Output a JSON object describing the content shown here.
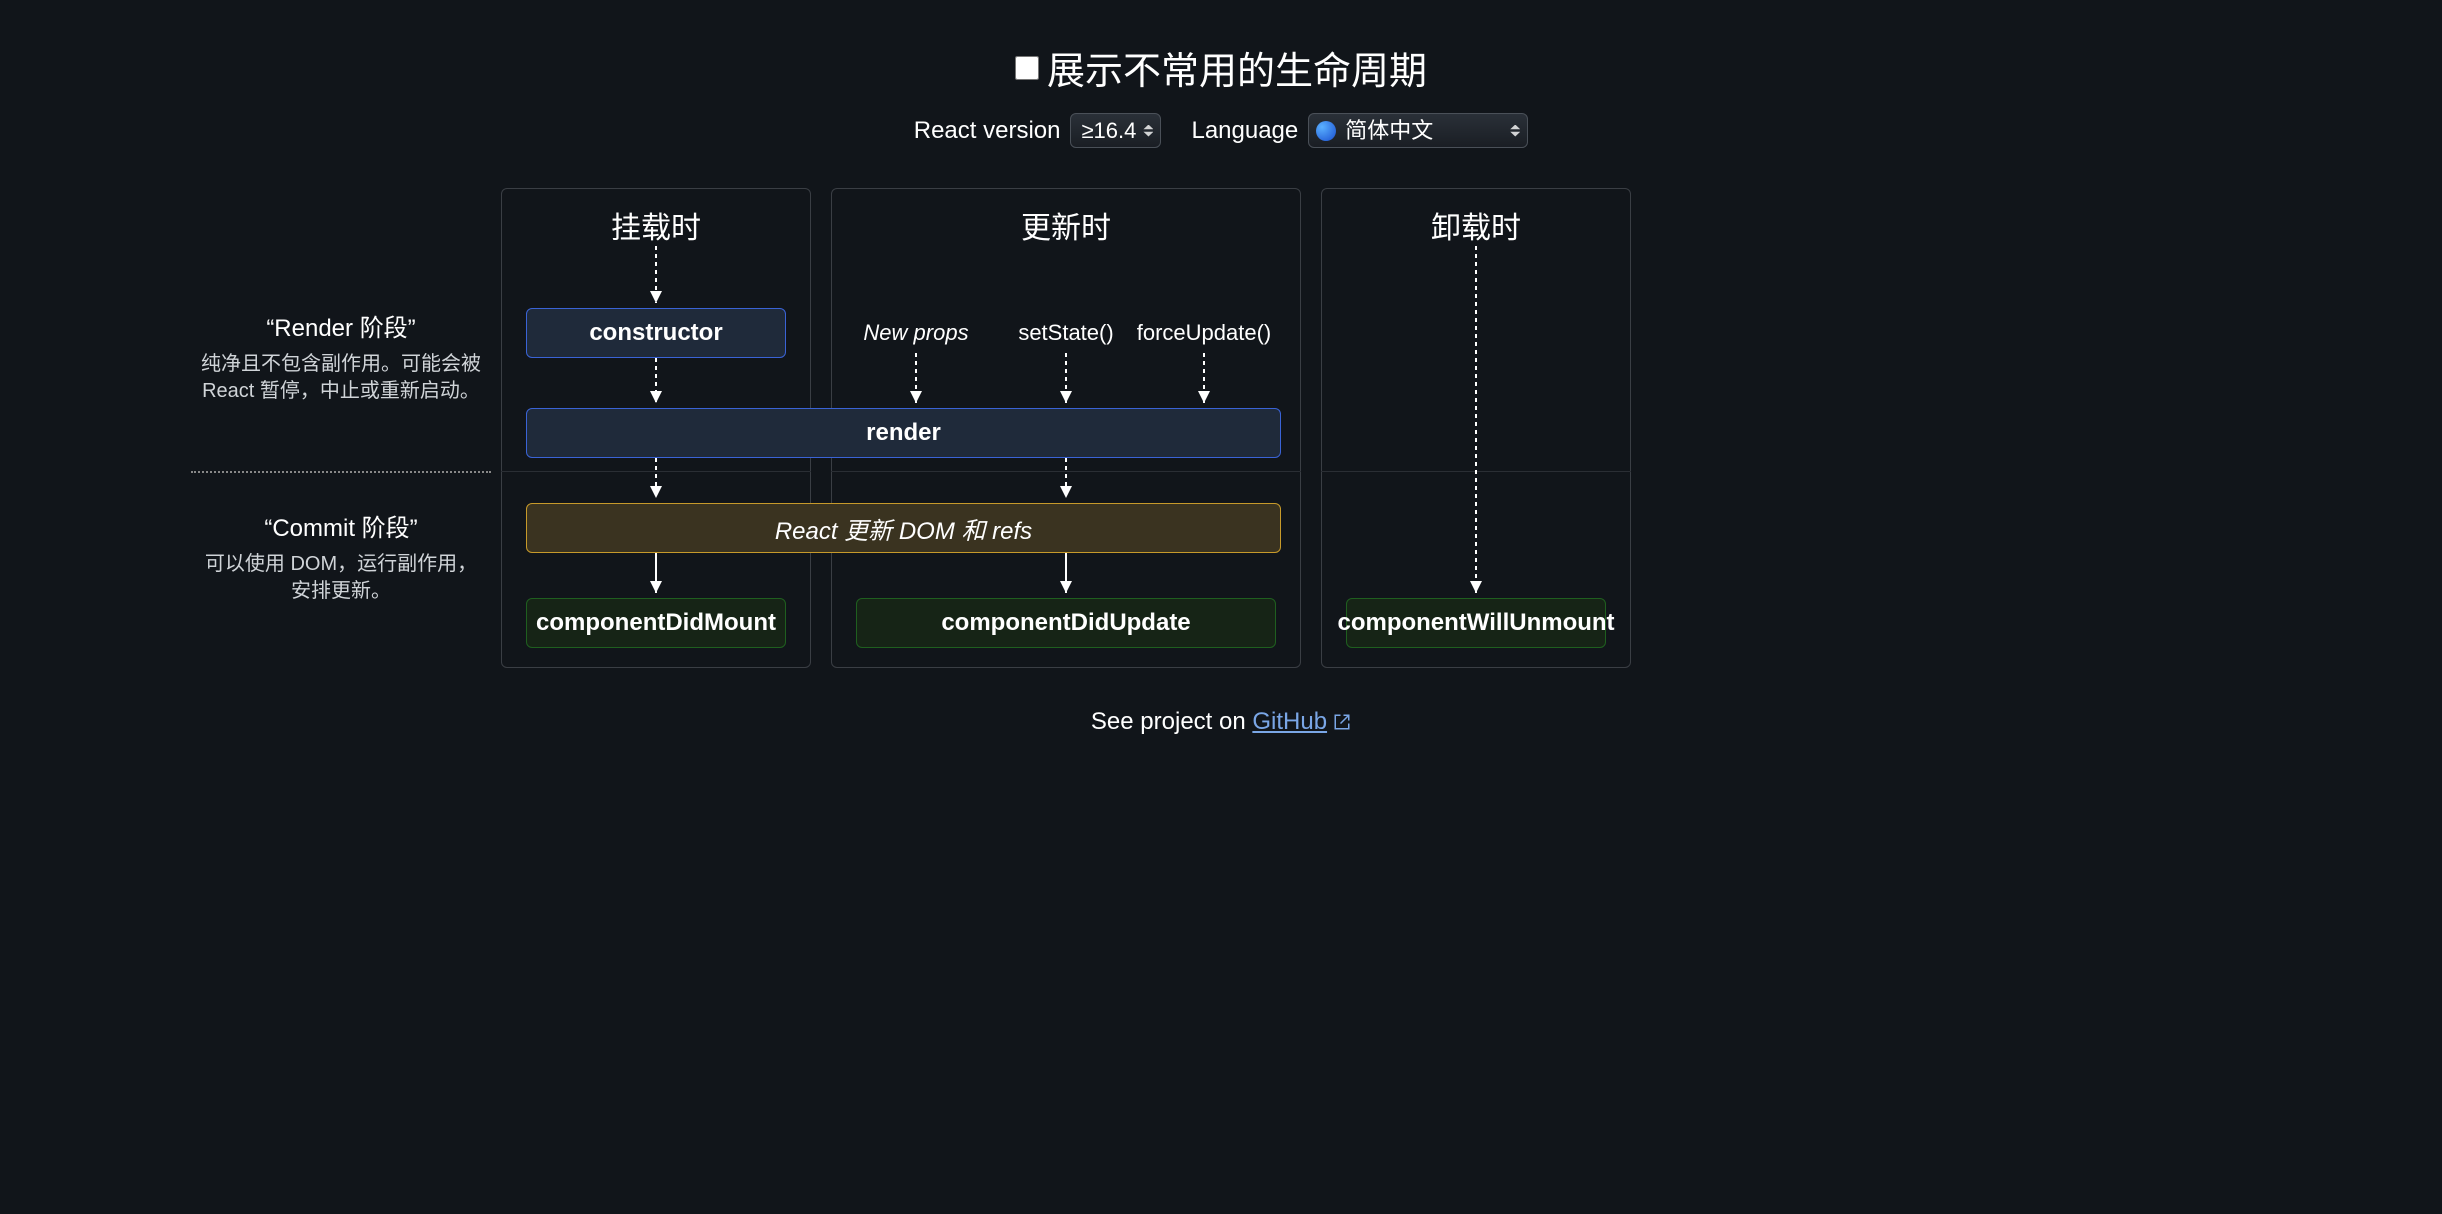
{
  "header": {
    "checkbox_label": "展示不常用的生命周期",
    "version_label": "React version",
    "version_value": "≥16.4",
    "language_label": "Language",
    "language_value": "简体中文"
  },
  "phases": {
    "render": {
      "title": "“Render 阶段”",
      "desc": "纯净且不包含副作用。可能会被 React 暂停，中止或重新启动。"
    },
    "commit": {
      "title": "“Commit 阶段”",
      "desc": "可以使用 DOM，运行副作用，安排更新。"
    }
  },
  "columns": {
    "mount": {
      "title": "挂载时"
    },
    "update": {
      "title": "更新时"
    },
    "unmount": {
      "title": "卸载时"
    }
  },
  "nodes": {
    "constructor": "constructor",
    "render": "render",
    "dom": "React 更新 DOM 和 refs",
    "didMount": "componentDidMount",
    "didUpdate": "componentDidUpdate",
    "willUnmount": "componentWillUnmount"
  },
  "triggers": {
    "newProps": "New props",
    "setState": "setState()",
    "forceUpdate": "forceUpdate()"
  },
  "footer": {
    "prefix": "See project on ",
    "link_text": "GitHub"
  },
  "chart_data": {
    "type": "diagram",
    "title": "React 生命周期（简体中文）",
    "columns": [
      "挂载时",
      "更新时",
      "卸载时"
    ],
    "phases": [
      "Render 阶段",
      "Commit 阶段"
    ],
    "mount_flow": [
      "constructor",
      "render",
      "React 更新 DOM 和 refs",
      "componentDidMount"
    ],
    "update_flow": [
      [
        "New props",
        "setState()",
        "forceUpdate()"
      ],
      "render",
      "React 更新 DOM 和 refs",
      "componentDidUpdate"
    ],
    "unmount_flow": [
      "componentWillUnmount"
    ],
    "edges": [
      [
        "挂载时",
        "constructor",
        "dashed"
      ],
      [
        "constructor",
        "render",
        "dashed"
      ],
      [
        "New props",
        "render",
        "dashed"
      ],
      [
        "setState()",
        "render",
        "dashed"
      ],
      [
        "forceUpdate()",
        "render",
        "dashed"
      ],
      [
        "render",
        "React 更新 DOM 和 refs",
        "dashed-both-columns"
      ],
      [
        "React 更新 DOM 和 refs",
        "componentDidMount",
        "solid"
      ],
      [
        "React 更新 DOM 和 refs",
        "componentDidUpdate",
        "solid"
      ],
      [
        "卸载时",
        "componentWillUnmount",
        "dashed"
      ]
    ]
  }
}
